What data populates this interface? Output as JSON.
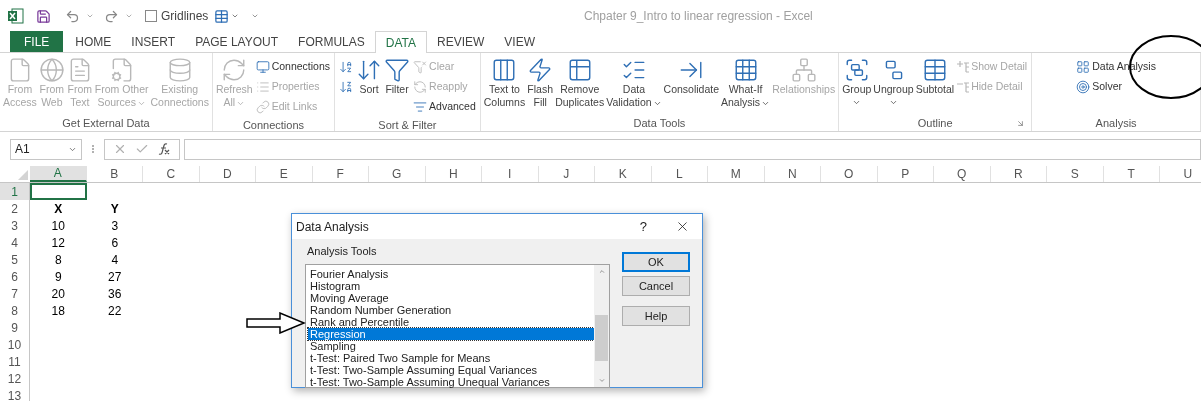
{
  "title_bar": {
    "gridlines": {
      "label": "Gridlines",
      "checked": false
    },
    "title": "Chpater 9_Intro to linear regression - Excel"
  },
  "tabs": [
    {
      "label": "FILE",
      "kind": "file"
    },
    {
      "label": "HOME",
      "kind": "tab",
      "selected": false
    },
    {
      "label": "INSERT",
      "kind": "tab",
      "selected": false
    },
    {
      "label": "PAGE LAYOUT",
      "kind": "tab",
      "selected": false
    },
    {
      "label": "FORMULAS",
      "kind": "tab",
      "selected": false
    },
    {
      "label": "DATA",
      "kind": "tab",
      "selected": true
    },
    {
      "label": "REVIEW",
      "kind": "tab",
      "selected": false
    },
    {
      "label": "VIEW",
      "kind": "tab",
      "selected": false
    }
  ],
  "ribbon": {
    "groups": [
      {
        "label": "Get External Data",
        "columns": [
          {
            "kind": "large",
            "lines": [
              "From",
              "Access"
            ],
            "disabled": true
          },
          {
            "kind": "large",
            "lines": [
              "From",
              "Web"
            ],
            "disabled": true
          },
          {
            "kind": "large",
            "lines": [
              "From",
              "Text"
            ],
            "disabled": true
          },
          {
            "kind": "large",
            "lines": [
              "From Other",
              "Sources"
            ],
            "disabled": true,
            "dropdown": true
          },
          {
            "kind": "large",
            "lines": [
              "Existing",
              "Connections"
            ],
            "disabled": true
          }
        ]
      },
      {
        "label": "Connections",
        "columns": [
          {
            "kind": "large",
            "lines": [
              "Refresh",
              "All"
            ],
            "disabled": true,
            "dropdown": true
          },
          {
            "kind": "stack",
            "items": [
              {
                "label": "Connections",
                "disabled": false
              },
              {
                "label": "Properties",
                "disabled": true
              },
              {
                "label": "Edit Links",
                "disabled": true
              }
            ]
          }
        ]
      },
      {
        "label": "Sort & Filter",
        "columns": [
          {
            "kind": "stack",
            "items": [
              {
                "disabled": false
              },
              {
                "disabled": false
              }
            ]
          },
          {
            "kind": "large",
            "lines": [
              "Sort"
            ],
            "disabled": false
          },
          {
            "kind": "large",
            "lines": [
              "Filter"
            ],
            "disabled": false
          },
          {
            "kind": "stack",
            "items": [
              {
                "label": "Clear",
                "disabled": true
              },
              {
                "label": "Reapply",
                "disabled": true
              },
              {
                "label": "Advanced",
                "disabled": false
              }
            ]
          }
        ]
      },
      {
        "label": "Data Tools",
        "columns": [
          {
            "kind": "large",
            "lines": [
              "Text to",
              "Columns"
            ],
            "disabled": false
          },
          {
            "kind": "large",
            "lines": [
              "Flash",
              "Fill"
            ],
            "disabled": false
          },
          {
            "kind": "large",
            "lines": [
              "Remove",
              "Duplicates"
            ],
            "disabled": false
          },
          {
            "kind": "large",
            "lines": [
              "Data",
              "Validation"
            ],
            "disabled": false,
            "dropdown": true
          },
          {
            "kind": "large",
            "lines": [
              "Consolidate"
            ],
            "disabled": false
          },
          {
            "kind": "large",
            "lines": [
              "What-If",
              "Analysis"
            ],
            "disabled": false,
            "dropdown": true
          },
          {
            "kind": "large",
            "lines": [
              "Relationships"
            ],
            "disabled": true
          }
        ]
      },
      {
        "label": "Outline",
        "dialog_launcher": true,
        "columns": [
          {
            "kind": "large",
            "lines": [
              "Group"
            ],
            "disabled": false,
            "dropdown": true
          },
          {
            "kind": "large",
            "lines": [
              "Ungroup"
            ],
            "disabled": false,
            "dropdown": true
          },
          {
            "kind": "large",
            "lines": [
              "Subtotal"
            ],
            "disabled": false
          },
          {
            "kind": "stack",
            "items": [
              {
                "label": "Show Detail",
                "disabled": true
              },
              {
                "label": "Hide Detail",
                "disabled": true
              }
            ]
          }
        ]
      },
      {
        "label": "Analysis",
        "columns": [
          {
            "kind": "stack",
            "items": [
              {
                "label": "Data Analysis",
                "disabled": false
              },
              {
                "label": "Solver",
                "disabled": false
              }
            ]
          }
        ]
      }
    ]
  },
  "formula_bar": {
    "name_box": "A1"
  },
  "sheet": {
    "columns": [
      {
        "label": "A",
        "selected": true
      },
      {
        "label": "B",
        "selected": false
      },
      {
        "label": "C",
        "selected": false
      },
      {
        "label": "D",
        "selected": false
      },
      {
        "label": "E",
        "selected": false
      },
      {
        "label": "F",
        "selected": false
      },
      {
        "label": "G",
        "selected": false
      },
      {
        "label": "H",
        "selected": false
      },
      {
        "label": "I",
        "selected": false
      },
      {
        "label": "J",
        "selected": false
      },
      {
        "label": "K",
        "selected": false
      },
      {
        "label": "L",
        "selected": false
      },
      {
        "label": "M",
        "selected": false
      },
      {
        "label": "N",
        "selected": false
      },
      {
        "label": "O",
        "selected": false
      },
      {
        "label": "P",
        "selected": false
      },
      {
        "label": "Q",
        "selected": false
      },
      {
        "label": "R",
        "selected": false
      },
      {
        "label": "S",
        "selected": false
      },
      {
        "label": "T",
        "selected": false
      },
      {
        "label": "U",
        "selected": false
      }
    ],
    "rows": [
      {
        "label": "1",
        "selected": true
      },
      {
        "label": "2",
        "selected": false,
        "cells": [
          {
            "text": "X",
            "bold": true
          },
          {
            "text": "Y",
            "bold": true
          }
        ]
      },
      {
        "label": "3",
        "selected": false,
        "cells": [
          {
            "text": "10",
            "bold": false
          },
          {
            "text": "3",
            "bold": false
          }
        ]
      },
      {
        "label": "4",
        "selected": false,
        "cells": [
          {
            "text": "12",
            "bold": false
          },
          {
            "text": "6",
            "bold": false
          }
        ]
      },
      {
        "label": "5",
        "selected": false,
        "cells": [
          {
            "text": "8",
            "bold": false
          },
          {
            "text": "4",
            "bold": false
          }
        ]
      },
      {
        "label": "6",
        "selected": false,
        "cells": [
          {
            "text": "9",
            "bold": false
          },
          {
            "text": "27",
            "bold": false
          }
        ]
      },
      {
        "label": "7",
        "selected": false,
        "cells": [
          {
            "text": "20",
            "bold": false
          },
          {
            "text": "36",
            "bold": false
          }
        ]
      },
      {
        "label": "8",
        "selected": false,
        "cells": [
          {
            "text": "18",
            "bold": false
          },
          {
            "text": "22",
            "bold": false
          }
        ]
      },
      {
        "label": "9",
        "selected": false
      },
      {
        "label": "10",
        "selected": false
      },
      {
        "label": "11",
        "selected": false
      },
      {
        "label": "12",
        "selected": false
      },
      {
        "label": "13",
        "selected": false
      }
    ]
  },
  "dialog": {
    "title": "Data Analysis",
    "help": "?",
    "list_label": "Analysis Tools",
    "items": [
      {
        "label": "Fourier Analysis",
        "selected": false
      },
      {
        "label": "Histogram",
        "selected": false
      },
      {
        "label": "Moving Average",
        "selected": false
      },
      {
        "label": "Random Number Generation",
        "selected": false
      },
      {
        "label": "Rank and Percentile",
        "selected": false
      },
      {
        "label": "Regression",
        "selected": true
      },
      {
        "label": "Sampling",
        "selected": false
      },
      {
        "label": "t-Test: Paired Two Sample for Means",
        "selected": false
      },
      {
        "label": "t-Test: Two-Sample Assuming Equal Variances",
        "selected": false
      },
      {
        "label": "t-Test: Two-Sample Assuming Unequal Variances",
        "selected": false
      }
    ],
    "buttons": [
      {
        "label": "OK",
        "default": true
      },
      {
        "label": "Cancel",
        "default": false
      },
      {
        "label": "Help",
        "default": false
      }
    ]
  }
}
